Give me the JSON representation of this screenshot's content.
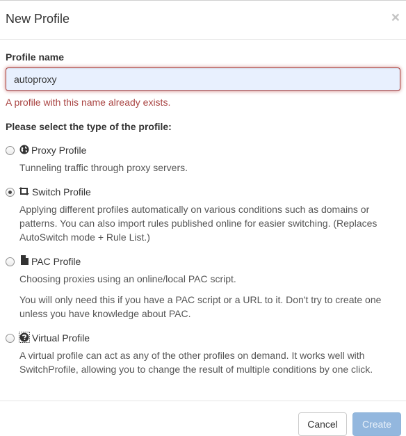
{
  "dialog": {
    "title": "New Profile",
    "close_glyph": "×"
  },
  "form": {
    "name_label": "Profile name",
    "name_value": "autoproxy",
    "error": "A profile with this name already exists.",
    "type_label": "Please select the type of the profile:"
  },
  "options": [
    {
      "label": "Proxy Profile",
      "icon": "globe-icon",
      "selected": false,
      "desc": [
        "Tunneling traffic through proxy servers."
      ]
    },
    {
      "label": "Switch Profile",
      "icon": "retweet-icon",
      "selected": true,
      "desc": [
        "Applying different profiles automatically on various conditions such as domains or patterns. You can also import rules published online for easier switching. (Replaces AutoSwitch mode + Rule List.)"
      ]
    },
    {
      "label": "PAC Profile",
      "icon": "file-icon",
      "selected": false,
      "desc": [
        "Choosing proxies using an online/local PAC script.",
        "You will only need this if you have a PAC script or a URL to it. Don't try to create one unless you have knowledge about PAC."
      ]
    },
    {
      "label": "Virtual Profile",
      "icon": "question-icon",
      "selected": false,
      "desc": [
        "A virtual profile can act as any of the other profiles on demand. It works well with SwitchProfile, allowing you to change the result of multiple conditions by one click."
      ]
    }
  ],
  "footer": {
    "cancel_label": "Cancel",
    "create_label": "Create"
  },
  "colors": {
    "error": "#a94442",
    "primary_disabled": "#93b7de"
  }
}
